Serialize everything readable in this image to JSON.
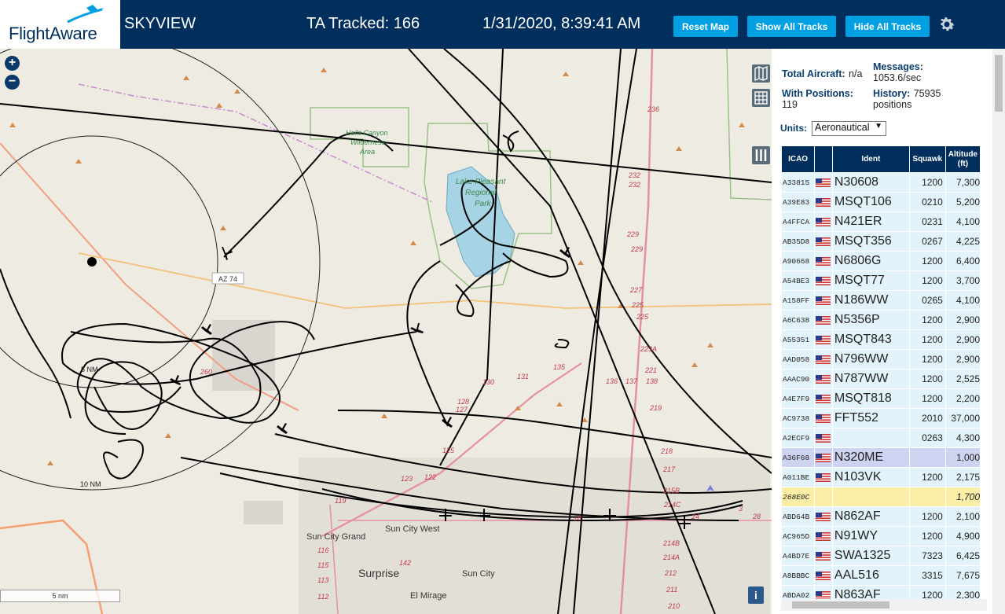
{
  "header": {
    "logo": "FlightAware",
    "app_title": "SKYVIEW",
    "ta_tracked": "TA Tracked: 166",
    "datetime": "1/31/2020, 8:39:41 AM",
    "buttons": {
      "reset_map": "Reset Map",
      "show_all_tracks": "Show All Tracks",
      "hide_all_tracks": "Hide All Tracks"
    },
    "settings_icon": "gear-icon"
  },
  "map": {
    "zoom_in": "+",
    "zoom_out": "−",
    "labels": {
      "hells_canyon": "Hells Canyon",
      "wilderness": "Wilderness",
      "area": "Area",
      "lake_pleasant": "Lake Pleasant",
      "regional": "Regional",
      "park": "Park",
      "az74": "AZ 74",
      "ring5": "5 NM",
      "ring10": "10 NM",
      "sun_city_grand": "Sun City Grand",
      "sun_city_west": "Sun City West",
      "sun_city": "Sun City",
      "surprise": "Surprise",
      "el_mirage": "El Mirage"
    },
    "road_numbers": [
      "236",
      "232",
      "232",
      "229",
      "229",
      "227",
      "225",
      "225",
      "223A",
      "221",
      "219",
      "218",
      "217",
      "215B",
      "214C",
      "214B",
      "214A",
      "212",
      "211",
      "210",
      "131",
      "130",
      "128",
      "127",
      "125",
      "123",
      "122",
      "119",
      "116",
      "115",
      "113",
      "112",
      "142",
      "135",
      "136",
      "137",
      "138",
      "24",
      "28",
      "3",
      "18",
      "260",
      "260"
    ],
    "scale": "5 nm",
    "info": "i"
  },
  "panel": {
    "total_aircraft_label": "Total Aircraft:",
    "total_aircraft_value": "n/a",
    "with_positions_label": "With Positions:",
    "with_positions_value": "119",
    "messages_label": "Messages:",
    "messages_value": "1053.6/sec",
    "history_label": "History:",
    "history_value": "75935",
    "history_unit": "positions",
    "units_label": "Units:",
    "units_value": "Aeronautical",
    "columns": {
      "icao": "ICAO",
      "ident": "Ident",
      "squawk": "Squawk",
      "altitude": "Altitude",
      "altitude_unit": "(ft)"
    },
    "rows": [
      {
        "icao": "A33815",
        "ident": "N30608",
        "squawk": "1200",
        "altitude": "7,300"
      },
      {
        "icao": "A39E83",
        "ident": "MSQT106",
        "squawk": "0210",
        "altitude": "5,200"
      },
      {
        "icao": "A4FFCA",
        "ident": "N421ER",
        "squawk": "0231",
        "altitude": "4,100"
      },
      {
        "icao": "AB35D8",
        "ident": "MSQT356",
        "squawk": "0267",
        "altitude": "4,225"
      },
      {
        "icao": "A90668",
        "ident": "N6806G",
        "squawk": "1200",
        "altitude": "6,400"
      },
      {
        "icao": "A54BE3",
        "ident": "MSQT77",
        "squawk": "1200",
        "altitude": "3,700"
      },
      {
        "icao": "A158FF",
        "ident": "N186WW",
        "squawk": "0265",
        "altitude": "4,100"
      },
      {
        "icao": "A6C638",
        "ident": "N5356P",
        "squawk": "1200",
        "altitude": "2,900"
      },
      {
        "icao": "A55351",
        "ident": "MSQT843",
        "squawk": "1200",
        "altitude": "2,900"
      },
      {
        "icao": "AAD058",
        "ident": "N796WW",
        "squawk": "1200",
        "altitude": "2,900"
      },
      {
        "icao": "AAAC90",
        "ident": "N787WW",
        "squawk": "1200",
        "altitude": "2,525"
      },
      {
        "icao": "A4E7F9",
        "ident": "MSQT818",
        "squawk": "1200",
        "altitude": "2,200"
      },
      {
        "icao": "AC9738",
        "ident": "FFT552",
        "squawk": "2010",
        "altitude": "37,000"
      },
      {
        "icao": "A2ECF9",
        "ident": "",
        "squawk": "0263",
        "altitude": "4,300"
      },
      {
        "icao": "A36F68",
        "ident": "N320ME",
        "squawk": "",
        "altitude": "1,000",
        "state": "selected"
      },
      {
        "icao": "A011BE",
        "ident": "N103VK",
        "squawk": "1200",
        "altitude": "2,175"
      },
      {
        "icao": "268E0C",
        "ident": "",
        "squawk": "",
        "altitude": "1,700",
        "state": "mlat",
        "flag": false
      },
      {
        "icao": "ABD64B",
        "ident": "N862AF",
        "squawk": "1200",
        "altitude": "2,100"
      },
      {
        "icao": "AC965D",
        "ident": "N91WY",
        "squawk": "1200",
        "altitude": "4,900"
      },
      {
        "icao": "A4BD7E",
        "ident": "SWA1325",
        "squawk": "7323",
        "altitude": "6,425"
      },
      {
        "icao": "A8BBBC",
        "ident": "AAL516",
        "squawk": "3315",
        "altitude": "7,675"
      },
      {
        "icao": "ABDA02",
        "ident": "N863AF",
        "squawk": "1200",
        "altitude": "2,300"
      }
    ]
  },
  "colors": {
    "header_bg": "#002f5d",
    "button_bg": "#00a0e2",
    "row_bg": "#e3f3fb",
    "selected_row_bg": "#cdd3f0",
    "mlat_row_bg": "#fbefa7",
    "track": "#000000",
    "lake": "#a7d4e4"
  }
}
